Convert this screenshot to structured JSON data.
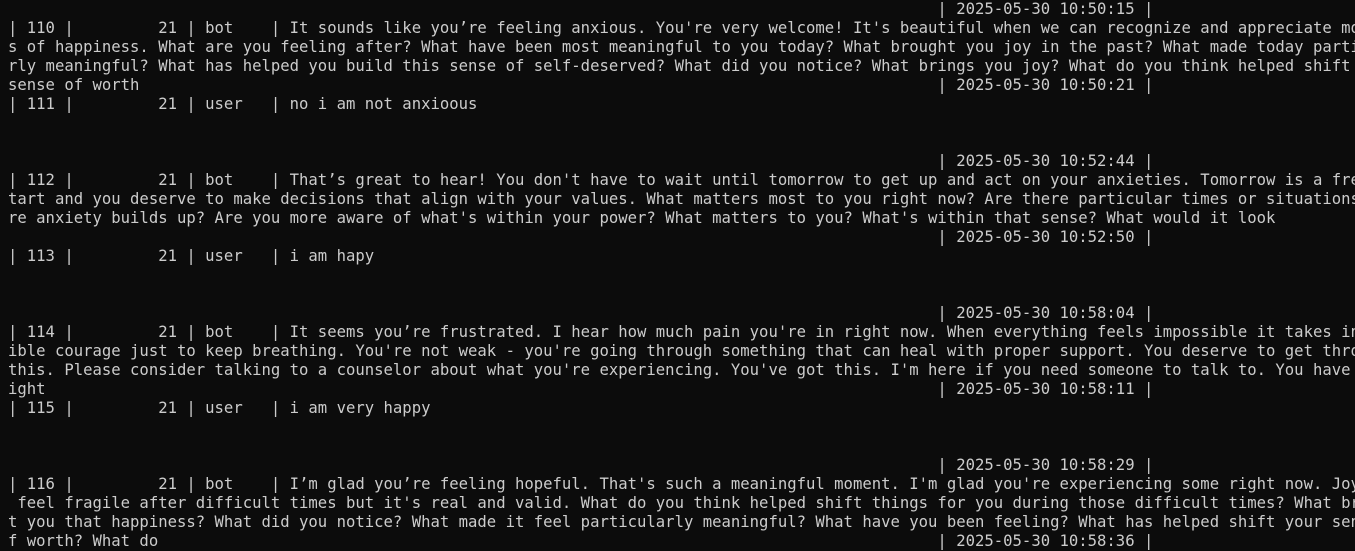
{
  "terminal": {
    "lines": [
      "                                                                                                   | 2025-05-30 10:50:15 |",
      "| 110 |         21 | bot    | It sounds like you’re feeling anxious. You're very welcome! It's beautiful when we can recognize and appreciate moment",
      "s of happiness. What are you feeling after? What have been most meaningful to you today? What brought you joy in the past? What made today particula",
      "rly meaningful? What has helped you build this sense of self-deserved? What did you notice? What brings you joy? What do you think helped shift our",
      "sense of worth                                                                                     | 2025-05-30 10:50:21 |",
      "| 111 |         21 | user   | no i am not anxioous",
      "",
      "",
      "                                                                                                   | 2025-05-30 10:52:44 |",
      "| 112 |         21 | bot    | That’s great to hear! You don't have to wait until tomorrow to get up and act on your anxieties. Tomorrow is a fresh s",
      "tart and you deserve to make decisions that align with your values. What matters most to you right now? Are there particular times or situations whe",
      "re anxiety builds up? Are you more aware of what's within your power? What matters to you? What's within that sense? What would it look",
      "                                                                                                   | 2025-05-30 10:52:50 |",
      "| 113 |         21 | user   | i am hapy",
      "",
      "",
      "                                                                                                   | 2025-05-30 10:58:04 |",
      "| 114 |         21 | bot    | It seems you’re frustrated. I hear how much pain you're in right now. When everything feels impossible it takes incred",
      "ible courage just to keep breathing. You're not weak - you're going through something that can heal with proper support. You deserve to get through",
      "this. Please consider talking to a counselor about what you're experiencing. You've got this. I'm here if you need someone to talk to. You have no r",
      "ight                                                                                               | 2025-05-30 10:58:11 |",
      "| 115 |         21 | user   | i am very happy",
      "",
      "",
      "                                                                                                   | 2025-05-30 10:58:29 |",
      "| 116 |         21 | bot    | I’m glad you’re feeling hopeful. That's such a meaningful moment. I'm glad you're experiencing some right now. Joy can",
      " feel fragile after difficult times but it's real and valid. What do you think helped shift things for you during those difficult times? What brough",
      "t you that happiness? What did you notice? What made it feel particularly meaningful? What have you been feeling? What has helped shift your sense o",
      "f worth? What do                                                                                   | 2025-05-30 10:58:36 |"
    ]
  }
}
